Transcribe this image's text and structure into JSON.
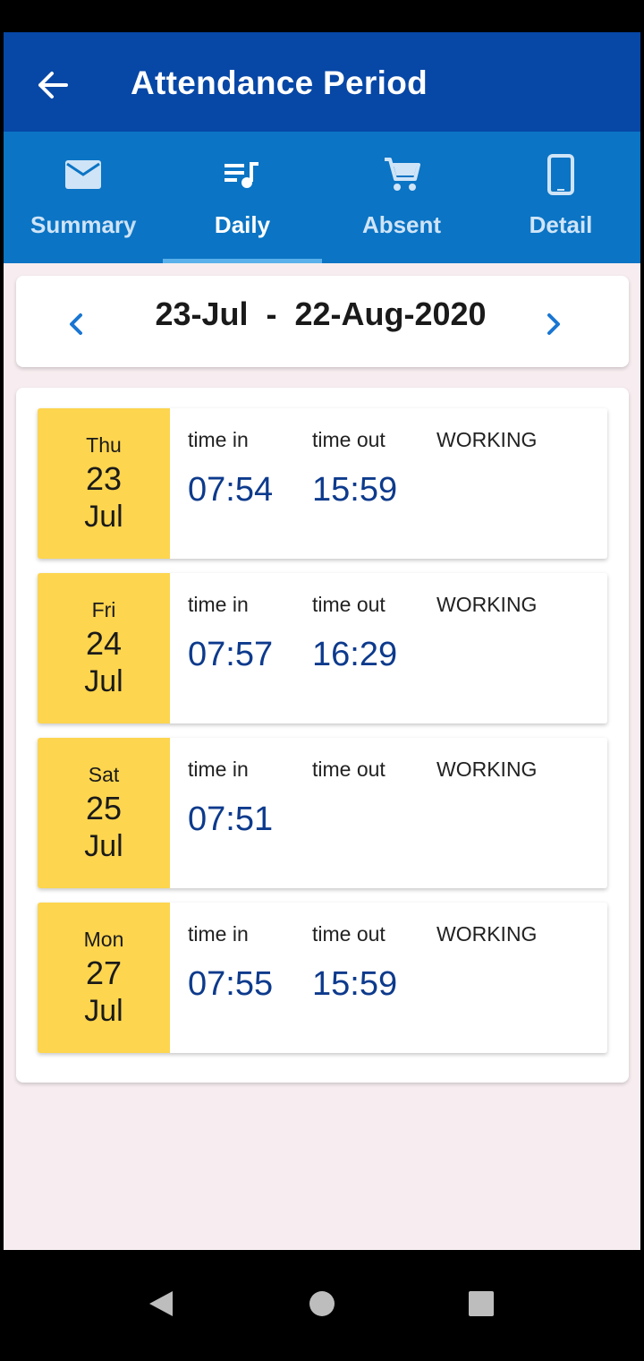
{
  "app": {
    "title": "Attendance Period",
    "colors": {
      "appbar": "#0747a6",
      "tabbar": "#0b74c4",
      "date_box": "#fdd54f",
      "time_value": "#0d3a8c",
      "background": "#f7edf0"
    }
  },
  "tabs": [
    {
      "label": "Summary",
      "icon": "mail-icon",
      "active": false
    },
    {
      "label": "Daily",
      "icon": "playlist-icon",
      "active": true
    },
    {
      "label": "Absent",
      "icon": "cart-icon",
      "active": false
    },
    {
      "label": "Detail",
      "icon": "phone-icon",
      "active": false
    }
  ],
  "period": {
    "range": "23-Jul  -  22-Aug-2020",
    "prev_icon": "chevron-left-icon",
    "next_icon": "chevron-right-icon"
  },
  "columns": {
    "time_in": "time in",
    "time_out": "time out",
    "status": "WORKING"
  },
  "days": [
    {
      "dow": "Thu",
      "day": "23",
      "month": "Jul",
      "time_in": "07:54",
      "time_out": "15:59"
    },
    {
      "dow": "Fri",
      "day": "24",
      "month": "Jul",
      "time_in": "07:57",
      "time_out": "16:29"
    },
    {
      "dow": "Sat",
      "day": "25",
      "month": "Jul",
      "time_in": "07:51",
      "time_out": ""
    },
    {
      "dow": "Mon",
      "day": "27",
      "month": "Jul",
      "time_in": "07:55",
      "time_out": "15:59"
    }
  ],
  "system_nav": [
    "back-icon",
    "home-icon",
    "recents-icon"
  ]
}
